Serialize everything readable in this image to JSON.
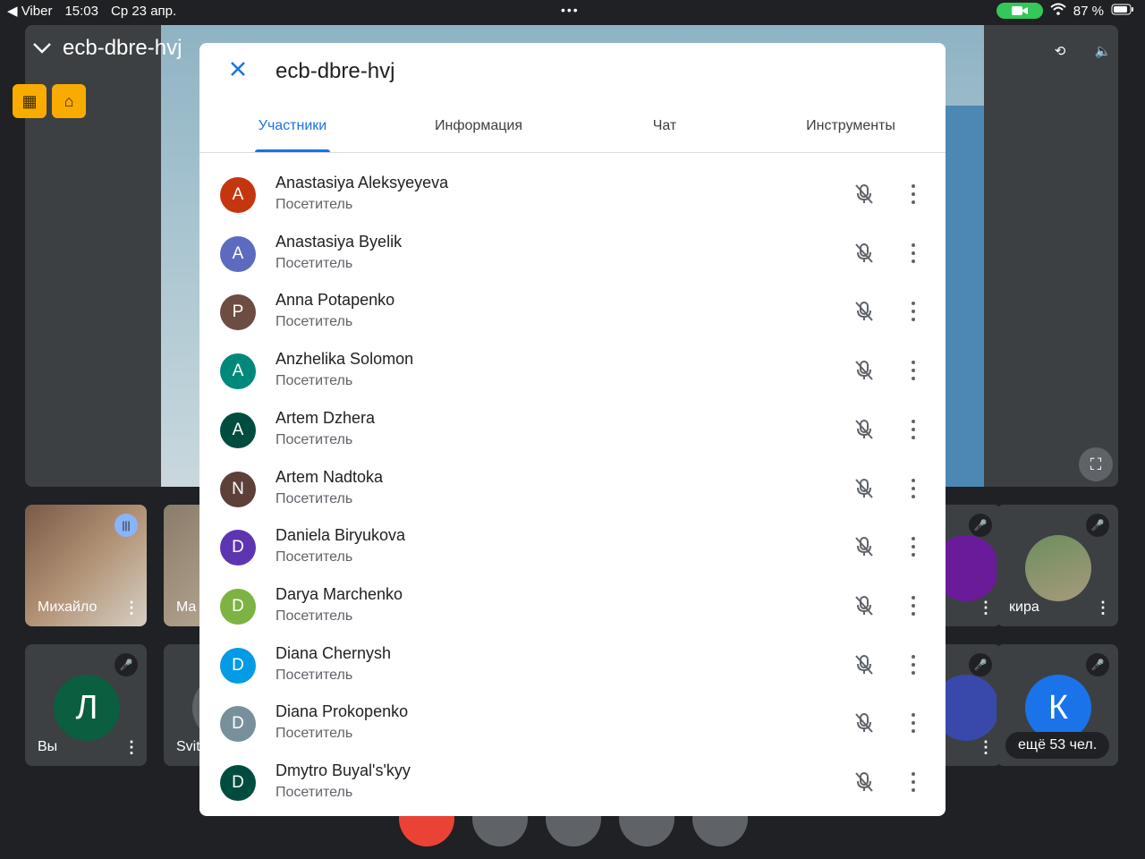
{
  "status_bar": {
    "back_app": "◀ Viber",
    "time": "15:03",
    "date": "Ср 23 апр.",
    "battery": "87 %"
  },
  "meeting": {
    "code": "ecb-dbre-hvj",
    "tiles": [
      {
        "name": "Михайло",
        "kind": "video"
      },
      {
        "name": "Ma",
        "kind": "video"
      },
      {
        "name": "кира",
        "kind": "photo"
      },
      {
        "name": "Вы",
        "kind": "avatar",
        "initial": "Л",
        "color": "#0b5e3f"
      },
      {
        "name": "Svit",
        "kind": "avatar"
      },
      {
        "name": "",
        "kind": "avatar",
        "initial": "К",
        "color": "#1a73e8",
        "more": "ещё 53 чел."
      }
    ]
  },
  "dialog": {
    "title": "ecb-dbre-hvj",
    "tabs": [
      {
        "label": "Участники",
        "active": true
      },
      {
        "label": "Информация",
        "active": false
      },
      {
        "label": "Чат",
        "active": false
      },
      {
        "label": "Инструменты",
        "active": false
      }
    ],
    "participants": [
      {
        "initial": "A",
        "name": "Anastasiya Aleksyeyeva",
        "role": "Посетитель",
        "color": "#c5360f"
      },
      {
        "initial": "A",
        "name": "Anastasiya Byelik",
        "role": "Посетитель",
        "color": "#5c6bc0"
      },
      {
        "initial": "P",
        "name": "Anna Potapenko",
        "role": "Посетитель",
        "color": "#6d4c41"
      },
      {
        "initial": "A",
        "name": "Anzhelika Solomon",
        "role": "Посетитель",
        "color": "#00897b"
      },
      {
        "initial": "A",
        "name": "Artem Dzhera",
        "role": "Посетитель",
        "color": "#004d40"
      },
      {
        "initial": "N",
        "name": "Artem Nadtoka",
        "role": "Посетитель",
        "color": "#5d4037"
      },
      {
        "initial": "D",
        "name": "Daniela Biryukova",
        "role": "Посетитель",
        "color": "#5e35b1"
      },
      {
        "initial": "D",
        "name": "Darya Marchenko",
        "role": "Посетитель",
        "color": "#7cb342"
      },
      {
        "initial": "D",
        "name": "Diana Chernysh",
        "role": "Посетитель",
        "color": "#039be5"
      },
      {
        "initial": "D",
        "name": "Diana Prokopenko",
        "role": "Посетитель",
        "color": "#78909c"
      },
      {
        "initial": "D",
        "name": "Dmytro Buyal's'kyy",
        "role": "Посетитель",
        "color": "#004d40"
      }
    ]
  }
}
